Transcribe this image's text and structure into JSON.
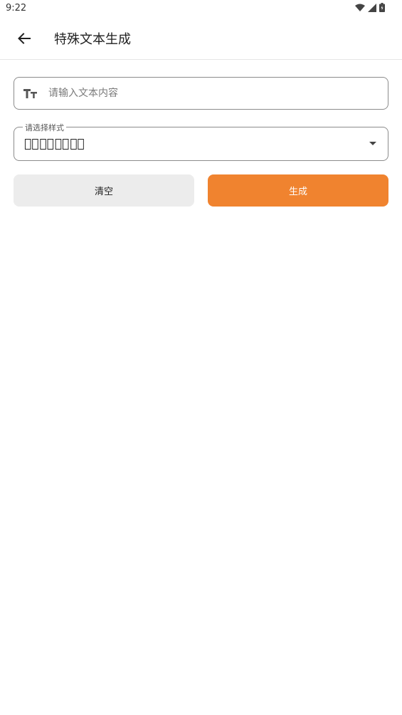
{
  "status_bar": {
    "time": "9:22"
  },
  "app_bar": {
    "title": "特殊文本生成"
  },
  "text_input": {
    "value": "",
    "placeholder": "请输入文本内容"
  },
  "style_select": {
    "label": "请选择样式",
    "selected": "测⃠试⃠测⃠试⃠"
  },
  "buttons": {
    "clear_label": "清空",
    "generate_label": "生成"
  },
  "colors": {
    "accent": "#f0832f",
    "secondary_button": "#ececec"
  }
}
